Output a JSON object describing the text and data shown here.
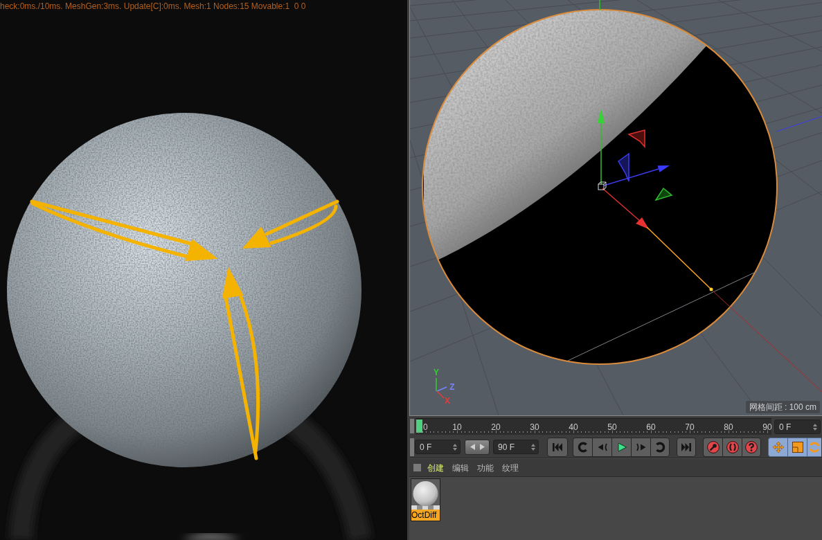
{
  "render_view": {
    "stats": "heck:0ms./10ms. MeshGen:3ms. Update[C]:0ms. Mesh:1 Nodes:15 Movable:1  0 0"
  },
  "viewport": {
    "axis_labels": [
      {
        "label": "Y",
        "color": "#33cc33"
      },
      {
        "label": "Z",
        "color": "#7884ff"
      },
      {
        "label": "X",
        "color": "#e83a3a"
      }
    ],
    "grid_spacing": "网格间距 : 100 cm"
  },
  "timeline": {
    "ticks": [
      "0",
      "10",
      "20",
      "30",
      "40",
      "50",
      "60",
      "70",
      "80",
      "90"
    ],
    "current_frame": "0 F"
  },
  "range": {
    "start": "0 F",
    "end": "90 F"
  },
  "toolbar": [
    {
      "buttons": [
        {
          "kind": "skip_start"
        }
      ]
    },
    {
      "buttons": [
        {
          "kind": "arc_back"
        },
        {
          "kind": "step_back"
        },
        {
          "kind": "play"
        },
        {
          "kind": "step_forward"
        },
        {
          "kind": "arc_forward"
        }
      ]
    },
    {
      "buttons": [
        {
          "kind": "skip_end"
        }
      ]
    },
    {
      "buttons": [
        {
          "kind": "key"
        },
        {
          "kind": "cycle"
        },
        {
          "kind": "question"
        }
      ]
    },
    {
      "buttons": [
        {
          "kind": "move",
          "on": true
        },
        {
          "kind": "scale",
          "on": true
        },
        {
          "kind": "rotate",
          "on": true
        }
      ]
    }
  ],
  "material_manager": {
    "menu": [
      {
        "label": "创建",
        "selected": true
      },
      {
        "label": "编辑",
        "selected": false
      },
      {
        "label": "功能",
        "selected": false
      },
      {
        "label": "纹理",
        "selected": false
      }
    ],
    "materials": [
      {
        "name": "OctDiff",
        "selected": true
      }
    ]
  }
}
